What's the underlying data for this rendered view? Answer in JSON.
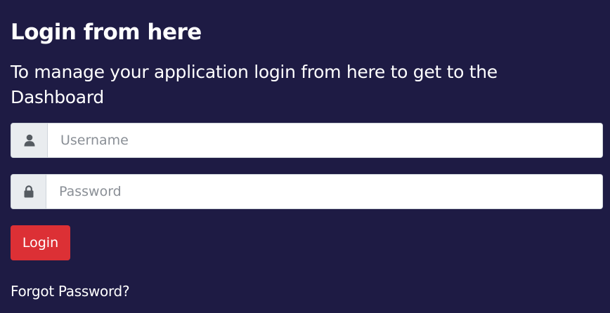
{
  "login_form": {
    "title": "Login from here",
    "subtitle": "To manage your application login from here to get to the Dashboard",
    "username": {
      "icon": "user-icon",
      "placeholder": "Username",
      "value": ""
    },
    "password": {
      "icon": "lock-icon",
      "placeholder": "Password",
      "value": ""
    },
    "login_label": "Login",
    "forgot_label": "Forgot Password?"
  },
  "colors": {
    "background": "#1e1b44",
    "login_button": "#dc3035",
    "addon_background": "#e9ecef",
    "text": "#ffffff"
  }
}
